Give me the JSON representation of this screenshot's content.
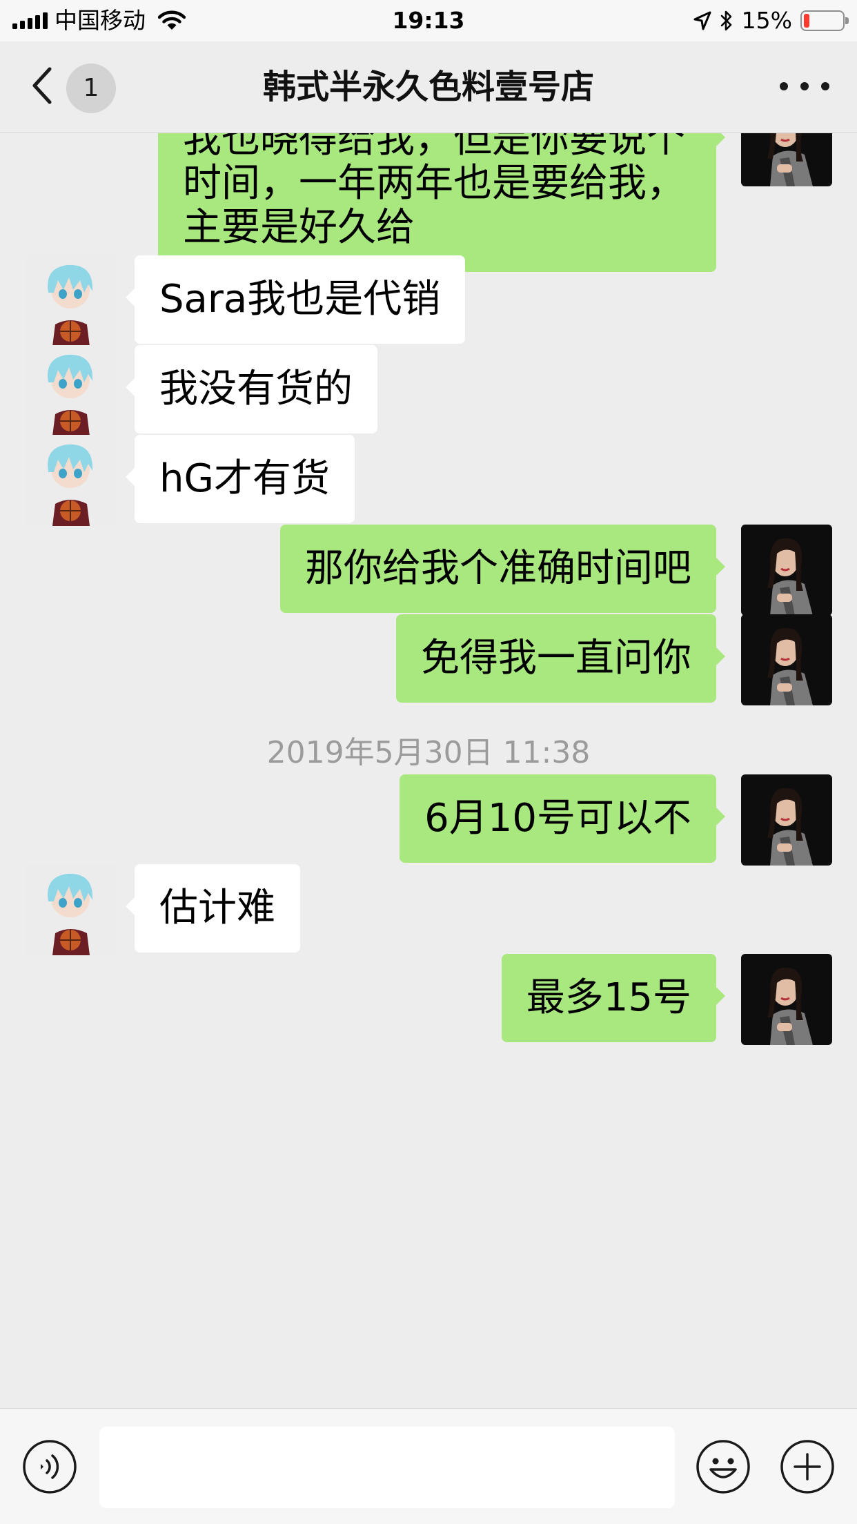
{
  "status_bar": {
    "carrier": "中国移动",
    "time": "19:13",
    "battery_percent": "15%",
    "battery_level": 0.15,
    "icons": [
      "signal-icon",
      "wifi-icon",
      "location-arrow-icon",
      "bluetooth-icon",
      "battery-icon"
    ]
  },
  "nav": {
    "back_icon": "chevron-left-icon",
    "unread_count": "1",
    "title": "韩式半永久色料壹号店",
    "more_icon": "more-dots-icon"
  },
  "messages": [
    {
      "side": "out",
      "text": "我也晓得给我，但是你要说个时间，一年两年也是要给我，主要是好久给"
    },
    {
      "side": "in",
      "text": "Sara我也是代销"
    },
    {
      "side": "in",
      "text": "我没有货的"
    },
    {
      "side": "in",
      "text": "hG才有货"
    },
    {
      "side": "out",
      "text": "那你给我个准确时间吧"
    },
    {
      "side": "out",
      "text": "免得我一直问你"
    },
    {
      "side": "time",
      "text": "2019年5月30日 11:38"
    },
    {
      "side": "out",
      "text": "6月10号可以不"
    },
    {
      "side": "in",
      "text": "估计难"
    },
    {
      "side": "out",
      "text": "最多15号"
    }
  ],
  "input_bar": {
    "voice_icon": "voice-icon",
    "input_value": "",
    "emoji_icon": "emoji-icon",
    "plus_icon": "plus-icon"
  },
  "colors": {
    "outgoing_bubble": "#a9e87e",
    "incoming_bubble": "#ffffff",
    "background": "#ededed",
    "battery_low": "#ff3b30"
  }
}
